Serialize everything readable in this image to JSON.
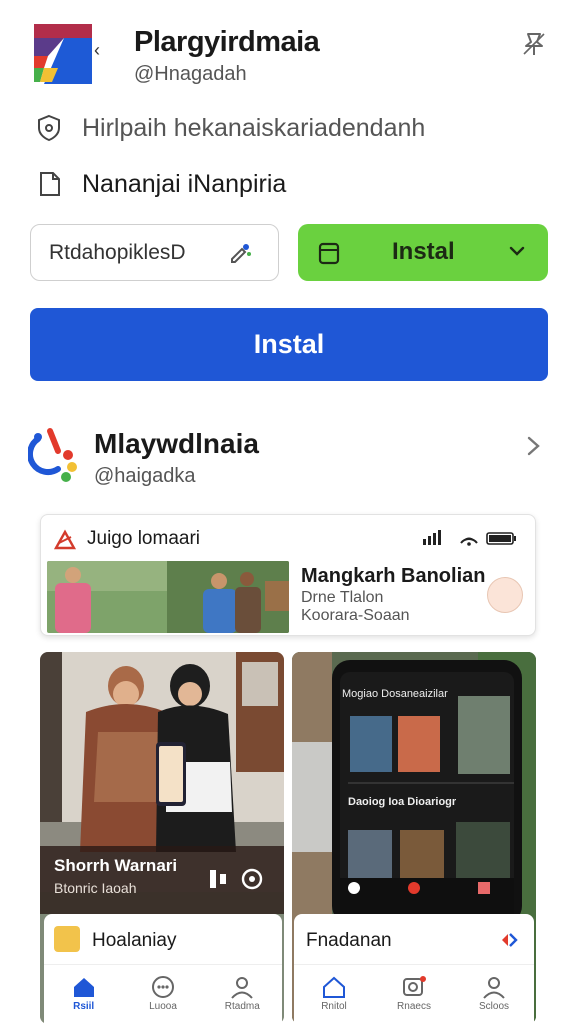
{
  "header": {
    "app_name": "Plargyirdmaia",
    "handle": "@Hnagadah"
  },
  "info_rows": [
    {
      "icon": "shield-icon",
      "text": "Hirlpaih hekanaiskariadendanh"
    },
    {
      "icon": "document-icon",
      "text": "Nananjai iNanpiria"
    }
  ],
  "input": {
    "value": "RtdahopiklesD"
  },
  "install_split": {
    "label": "Instal"
  },
  "install_primary": {
    "label": "Instal"
  },
  "section": {
    "title": "Mlaywdlnaia",
    "handle": "@haigadka"
  },
  "feature_card": {
    "title": "Juigo lomaari",
    "headline": "Mangkarh Banolian",
    "line1": "Drne Tlalon",
    "line2": "Koorara-Soaan"
  },
  "tiles": {
    "left_caption_title": "Shorrh Warnari",
    "left_caption_sub": "Btonric Iaoah",
    "phone_header": "Mogiao Dosaneaizilar",
    "phone_section": "Daoiog Ioa Dioariogr"
  },
  "bottom_cards": {
    "left_title": "Hoalaniay",
    "right_title": "Fnadanan"
  },
  "nav_left": [
    {
      "label": "Rsiil",
      "icon": "home-icon",
      "active": true
    },
    {
      "label": "Luooa",
      "icon": "chat-icon",
      "active": false
    },
    {
      "label": "Rtadma",
      "icon": "person-icon",
      "active": false
    }
  ],
  "nav_right": [
    {
      "label": "Rnitol",
      "icon": "home-icon",
      "active": false
    },
    {
      "label": "Rnaecs",
      "icon": "search-icon",
      "active": false
    },
    {
      "label": "Scloos",
      "icon": "person-icon",
      "active": false
    }
  ],
  "colors": {
    "primary": "#1f57d6",
    "install_green": "#6ad13f",
    "text": "#1a1a1a"
  }
}
